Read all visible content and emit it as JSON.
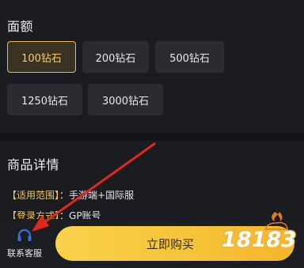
{
  "denomination": {
    "title": "面额",
    "options": [
      {
        "label": "100钻石",
        "selected": true
      },
      {
        "label": "200钻石",
        "selected": false
      },
      {
        "label": "500钻石",
        "selected": false
      },
      {
        "label": "1250钻石",
        "selected": false
      },
      {
        "label": "3000钻石",
        "selected": false
      }
    ]
  },
  "details": {
    "title": "商品详情",
    "scope_key": "【适用范围】",
    "scope_value": "：手游端+国际服",
    "login_key": "【登录方式】",
    "login_value": "：GP账号"
  },
  "bottom_bar": {
    "customer_service_label": "联系客服",
    "buy_label": "立即购买"
  },
  "watermark": {
    "text": "18183"
  },
  "colors": {
    "accent_gold": "#f3c74b",
    "buy_button": "#f6c338",
    "headset_blue": "#3b6fe0",
    "annotation_red": "#e0281f"
  }
}
